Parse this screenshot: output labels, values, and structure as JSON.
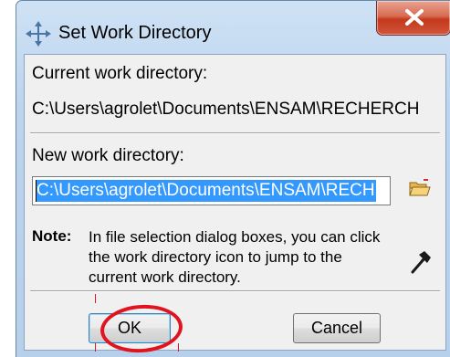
{
  "window": {
    "title": "Set Work Directory",
    "close_glyph": "X"
  },
  "dialog": {
    "current_label": "Current work directory:",
    "current_value": "C:\\Users\\agrolet\\Documents\\ENSAM\\RECHERCH",
    "new_label": "New work directory:",
    "new_value": "C:\\Users\\agrolet\\Documents\\ENSAM\\RECH",
    "note_label": "Note:",
    "note_text": "In file selection dialog boxes, you can click the work directory icon to jump to the current work directory."
  },
  "buttons": {
    "ok": "OK",
    "cancel": "Cancel"
  },
  "icons": {
    "title": "move-arrows-icon",
    "folder": "folder-open-icon",
    "jump": "hammer-icon",
    "close": "close-icon"
  },
  "colors": {
    "selection": "#3399ff",
    "annotation_circle": "#e0141e",
    "close_button": "#c3391c"
  }
}
